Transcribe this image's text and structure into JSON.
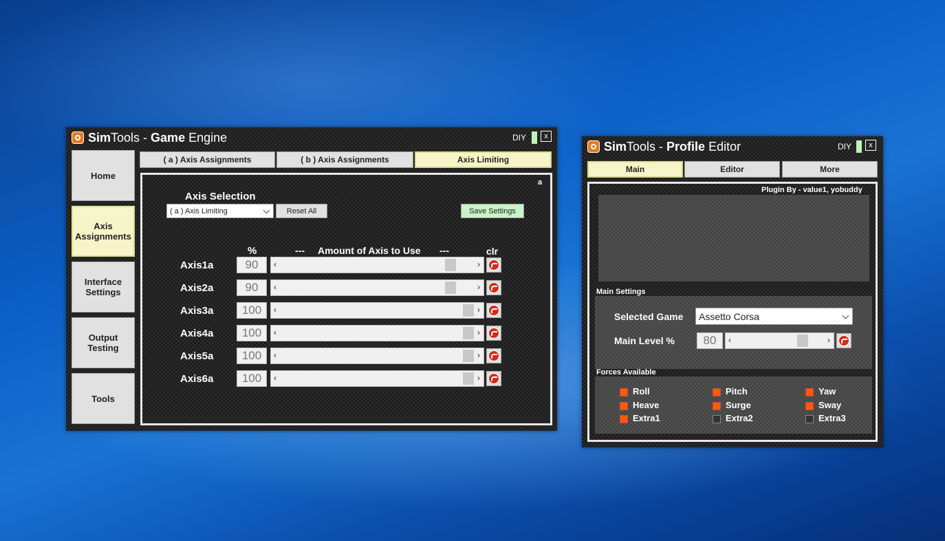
{
  "game_engine": {
    "title_brand_bold": "Sim",
    "title_brand": "Tools - ",
    "title_name_bold": "Game",
    "title_name": " Engine",
    "diy_label": "DIY",
    "close_label": "x",
    "sidebar": [
      {
        "label": "Home",
        "active": false
      },
      {
        "label": "Axis\nAssignments",
        "active": true
      },
      {
        "label": "Interface\nSettings",
        "active": false
      },
      {
        "label": "Output\nTesting",
        "active": false
      },
      {
        "label": "Tools",
        "active": false
      }
    ],
    "tabs": [
      {
        "label": "( a ) Axis Assignments",
        "active": false
      },
      {
        "label": "( b ) Axis Assignments",
        "active": false
      },
      {
        "label": "Axis Limiting",
        "active": true
      }
    ],
    "panel_tag": "a",
    "axis_selection_label": "Axis Selection",
    "axis_selection_value": "( a ) Axis Limiting",
    "reset_all_label": "Reset All",
    "save_settings_label": "Save Settings",
    "pct_header": "%",
    "dash_left": "---",
    "amount_header": "Amount of Axis to Use",
    "dash_right": "---",
    "clr_header": "clr",
    "axes": [
      {
        "name": "Axis1a",
        "value": "90",
        "level": 90
      },
      {
        "name": "Axis2a",
        "value": "90",
        "level": 90
      },
      {
        "name": "Axis3a",
        "value": "100",
        "level": 100
      },
      {
        "name": "Axis4a",
        "value": "100",
        "level": 100
      },
      {
        "name": "Axis5a",
        "value": "100",
        "level": 100
      },
      {
        "name": "Axis6a",
        "value": "100",
        "level": 100
      }
    ]
  },
  "profile_editor": {
    "title_brand_bold": "Sim",
    "title_brand": "Tools - ",
    "title_name_bold": "Profile",
    "title_name": " Editor",
    "diy_label": "DIY",
    "close_label": "x",
    "tabs": [
      {
        "label": "Main",
        "active": true
      },
      {
        "label": "Editor",
        "active": false
      },
      {
        "label": "More",
        "active": false
      }
    ],
    "plugin_by": "Plugin By - value1, yobuddy",
    "main_settings_label": "Main Settings",
    "selected_game_label": "Selected Game",
    "selected_game_value": "Assetto Corsa",
    "main_level_label": "Main Level %",
    "main_level_value": "80",
    "main_level": 80,
    "forces_label": "Forces Available",
    "forces": [
      {
        "label": "Roll",
        "checked": true
      },
      {
        "label": "Pitch",
        "checked": true
      },
      {
        "label": "Yaw",
        "checked": true
      },
      {
        "label": "Heave",
        "checked": true
      },
      {
        "label": "Surge",
        "checked": true
      },
      {
        "label": "Sway",
        "checked": true
      },
      {
        "label": "Extra1",
        "checked": true
      },
      {
        "label": "Extra2",
        "checked": false
      },
      {
        "label": "Extra3",
        "checked": false
      }
    ],
    "colors": {
      "checked": "#ff5a0a",
      "active_tab": "#f5f5c8",
      "save_button": "#c8f5c8"
    }
  }
}
